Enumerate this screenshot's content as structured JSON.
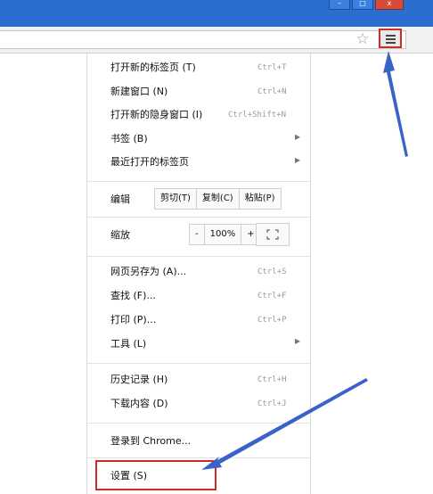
{
  "window": {
    "min_glyph": "–",
    "max_glyph": "□",
    "close_glyph": "x"
  },
  "toolbar": {
    "star_glyph": "☆"
  },
  "menu": {
    "new_tab": {
      "label": "打开新的标签页 (T)",
      "shortcut": "Ctrl+T"
    },
    "new_window": {
      "label": "新建窗口 (N)",
      "shortcut": "Ctrl+N"
    },
    "new_incognito": {
      "label": "打开新的隐身窗口 (I)",
      "shortcut": "Ctrl+Shift+N"
    },
    "bookmarks": {
      "label": "书签 (B)",
      "arrow": "▶"
    },
    "recent_tabs": {
      "label": "最近打开的标签页",
      "arrow": "▶"
    },
    "edit": {
      "label": "编辑",
      "cut": "剪切(T)",
      "copy": "复制(C)",
      "paste": "粘贴(P)"
    },
    "zoom": {
      "label": "缩放",
      "minus": "-",
      "value": "100%",
      "plus": "+",
      "fullscreen_glyph": "⛶"
    },
    "save_as": {
      "label": "网页另存为 (A)...",
      "shortcut": "Ctrl+S"
    },
    "find": {
      "label": "查找 (F)...",
      "shortcut": "Ctrl+F"
    },
    "print": {
      "label": "打印 (P)...",
      "shortcut": "Ctrl+P"
    },
    "tools": {
      "label": "工具 (L)",
      "arrow": "▶"
    },
    "history": {
      "label": "历史记录 (H)",
      "shortcut": "Ctrl+H"
    },
    "downloads": {
      "label": "下载内容 (D)",
      "shortcut": "Ctrl+J"
    },
    "sign_in": {
      "label": "登录到 Chrome..."
    },
    "settings": {
      "label": "设置 (S)"
    }
  },
  "colors": {
    "titlebar": "#2a6fd0",
    "highlight_frame": "#d02a2a",
    "annotation_arrow": "#3a63c9"
  }
}
